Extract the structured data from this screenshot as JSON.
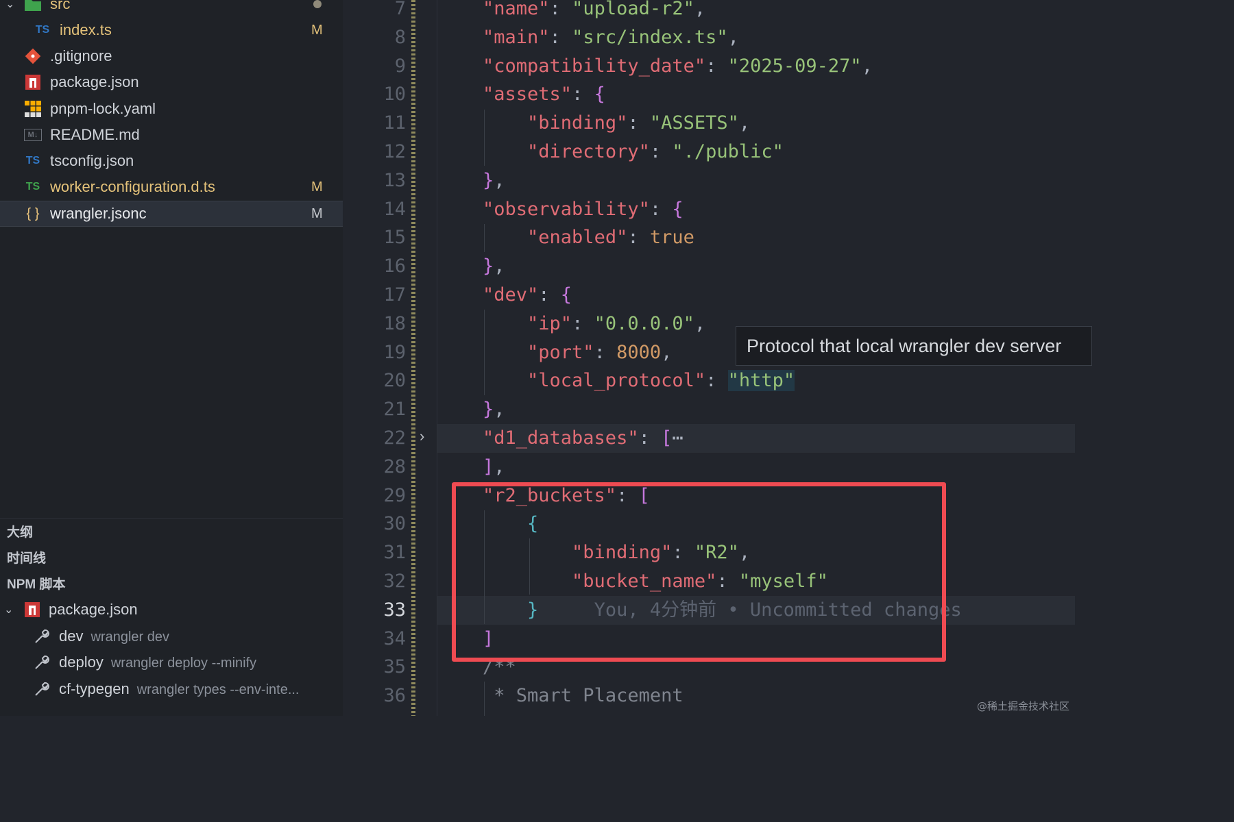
{
  "explorer": {
    "files": [
      {
        "name": "src",
        "icon": "folder-icon",
        "badge": "",
        "status": "modified-dot"
      },
      {
        "name": "index.ts",
        "icon": "ts-icon",
        "badge": "M"
      },
      {
        "name": ".gitignore",
        "icon": "git-icon",
        "badge": ""
      },
      {
        "name": "package.json",
        "icon": "npm-icon",
        "badge": ""
      },
      {
        "name": "pnpm-lock.yaml",
        "icon": "pnpm-icon",
        "badge": ""
      },
      {
        "name": "README.md",
        "icon": "markdown-icon",
        "badge": ""
      },
      {
        "name": "tsconfig.json",
        "icon": "tsconfig-icon",
        "badge": ""
      },
      {
        "name": "worker-configuration.d.ts",
        "icon": "ts-icon",
        "badge": "M"
      },
      {
        "name": "wrangler.jsonc",
        "icon": "json-braces-icon",
        "badge": "M"
      }
    ],
    "icon_labels": {
      "ts": "TS",
      "git": "◆",
      "md": "M↓",
      "json": "{ }"
    }
  },
  "panels": {
    "outline": "大纲",
    "timeline": "时间线",
    "npm_scripts": "NPM 脚本",
    "npm_package": "package.json",
    "scripts": [
      {
        "name": "dev",
        "command": "wrangler dev"
      },
      {
        "name": "deploy",
        "command": "wrangler deploy --minify"
      },
      {
        "name": "cf-typegen",
        "command": "wrangler types --env-inte..."
      }
    ]
  },
  "editor": {
    "active_line": "33",
    "tooltip": "Protocol that local wrangler dev server",
    "blame": "You, 4分钟前 • Uncommitted changes",
    "lines": [
      {
        "n": "7",
        "key": "\"name\"",
        "val": "\"upload-r2\""
      },
      {
        "n": "8",
        "key": "\"main\"",
        "val": "\"src/index.ts\""
      },
      {
        "n": "9",
        "key": "\"compatibility_date\"",
        "val": "\"2025-09-27\""
      },
      {
        "n": "10",
        "key": "\"assets\""
      },
      {
        "n": "11",
        "key": "\"binding\"",
        "val": "\"ASSETS\""
      },
      {
        "n": "12",
        "key": "\"directory\"",
        "val": "\"./public\""
      },
      {
        "n": "13"
      },
      {
        "n": "14",
        "key": "\"observability\""
      },
      {
        "n": "15",
        "key": "\"enabled\"",
        "val": "true"
      },
      {
        "n": "16"
      },
      {
        "n": "17",
        "key": "\"dev\""
      },
      {
        "n": "18",
        "key": "\"ip\"",
        "val": "\"0.0.0.0\""
      },
      {
        "n": "19",
        "key": "\"port\"",
        "val": "8000"
      },
      {
        "n": "20",
        "key": "\"local_protocol\"",
        "val": "\"http\""
      },
      {
        "n": "21"
      },
      {
        "n": "22",
        "key": "\"d1_databases\"",
        "folded": "⋯"
      },
      {
        "n": "28"
      },
      {
        "n": "29",
        "key": "\"r2_buckets\""
      },
      {
        "n": "30"
      },
      {
        "n": "31",
        "key": "\"binding\"",
        "val": "\"R2\""
      },
      {
        "n": "32",
        "key": "\"bucket_name\"",
        "val": "\"myself\""
      },
      {
        "n": "33"
      },
      {
        "n": "34"
      },
      {
        "n": "35",
        "comment": "/**"
      },
      {
        "n": "36",
        "comment": "* Smart Placement"
      }
    ]
  },
  "watermark": "@稀土掘金技术社区",
  "colors": {
    "accent_highlight": "#ef4b52",
    "modified": "#e4c27a",
    "ts_blue": "#3178c6"
  }
}
